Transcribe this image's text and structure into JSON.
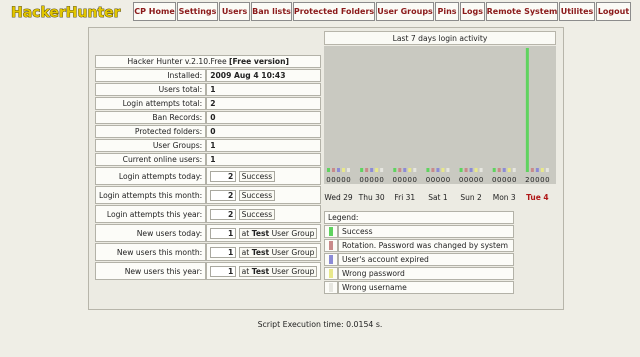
{
  "app": {
    "logo_text": "HackerHunter"
  },
  "nav": [
    {
      "label": "CP Home"
    },
    {
      "label": "Settings"
    },
    {
      "label": "Users"
    },
    {
      "label": "Ban lists"
    },
    {
      "label": "Protected Folders"
    },
    {
      "label": "User Groups"
    },
    {
      "label": "Pins"
    },
    {
      "label": "Logs"
    },
    {
      "label": "Remote System"
    },
    {
      "label": "Utilites"
    },
    {
      "label": "Logout"
    }
  ],
  "stats": {
    "version_prefix": "Hacker Hunter v.2.10.Free",
    "version_edition": "[Free version]",
    "installed_label": "Installed:",
    "installed_value": "2009 Aug 4 10:43",
    "users_total_label": "Users total:",
    "users_total_value": "1",
    "login_attempts_total_label": "Login attempts total:",
    "login_attempts_total_value": "2",
    "ban_records_label": "Ban Records:",
    "ban_records_value": "0",
    "protected_folders_label": "Protected folders:",
    "protected_folders_value": "0",
    "user_groups_label": "User Groups:",
    "user_groups_value": "1",
    "online_users_label": "Current online users:",
    "online_users_value": "1",
    "login_today_label": "Login attempts today:",
    "login_today_value": "2",
    "login_today_status": "Success",
    "login_month_label": "Login attempts this month:",
    "login_month_value": "2",
    "login_month_status": "Success",
    "login_year_label": "Login attempts this year:",
    "login_year_value": "2",
    "login_year_status": "Success",
    "new_today_label": "New users today:",
    "new_today_value": "1",
    "new_today_at": "at",
    "new_today_group": "Test",
    "new_today_suffix": "User Group",
    "new_month_label": "New users this month:",
    "new_month_value": "1",
    "new_month_at": "at",
    "new_month_group": "Test",
    "new_month_suffix": "User Group",
    "new_year_label": "New users this year:",
    "new_year_value": "1",
    "new_year_at": "at",
    "new_year_group": "Test",
    "new_year_suffix": "User Group"
  },
  "chart_data": {
    "type": "bar",
    "title": "Last 7 days login activity",
    "categories": [
      "Wed 29",
      "Thu 30",
      "Fri 31",
      "Sat 1",
      "Sun 2",
      "Mon 3",
      "Tue 4"
    ],
    "highlight_category": "Tue 4",
    "series": [
      {
        "name": "Success",
        "color": "#5fd35f",
        "values": [
          0,
          0,
          0,
          0,
          0,
          0,
          2
        ]
      },
      {
        "name": "Rotation. Password was changed by system",
        "color": "#c98a8a",
        "values": [
          0,
          0,
          0,
          0,
          0,
          0,
          0
        ]
      },
      {
        "name": "User's account expired",
        "color": "#8b8bd6",
        "values": [
          0,
          0,
          0,
          0,
          0,
          0,
          0
        ]
      },
      {
        "name": "Wrong password",
        "color": "#e8e88a",
        "values": [
          0,
          0,
          0,
          0,
          0,
          0,
          0
        ]
      },
      {
        "name": "Wrong username",
        "color": "#e6e6e0",
        "values": [
          0,
          0,
          0,
          0,
          0,
          0,
          0
        ]
      }
    ],
    "ylim": [
      0,
      2
    ],
    "legend_title": "Legend:",
    "legend_position": "bottom-left"
  },
  "footer": {
    "text": "Script Execution time: 0.0154 s."
  },
  "colors": {
    "nav_text": "#8b1a1a",
    "logo_fill": "#e2c600",
    "logo_stroke": "#3a2f00",
    "chart_bg": "#c9c9c1",
    "highlight_text": "#b01818"
  }
}
